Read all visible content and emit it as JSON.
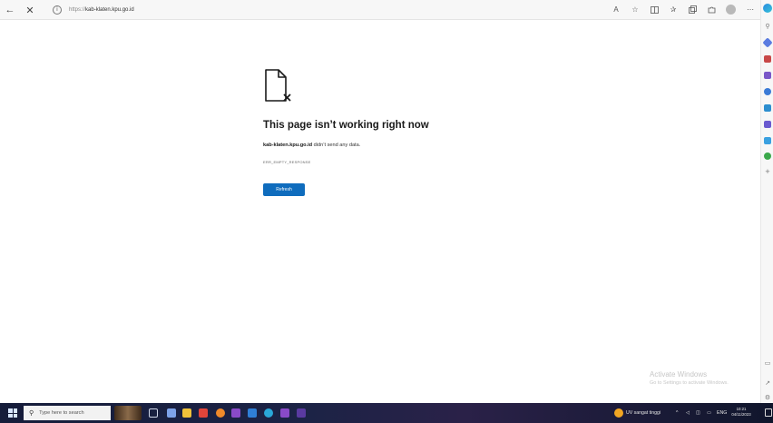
{
  "browser": {
    "url_protocol": "https://",
    "url_host": "kab-klaten.kpu.go.id",
    "back_glyph": "←",
    "close_glyph": "✕"
  },
  "error_page": {
    "title": "This page isn’t working right now",
    "site": "kab-klaten.kpu.go.id",
    "message": " didn’t send any data.",
    "error_code": "ERR_EMPTY_RESPONSE",
    "refresh_label": "Refresh"
  },
  "watermark": {
    "line1": "Activate Windows",
    "line2": "Go to Settings to activate Windows."
  },
  "taskbar": {
    "search_placeholder": "Type here to search",
    "weather_text": "UV sangat tinggi",
    "language": "ENG",
    "time": "10:21",
    "date": "04/11/2023"
  },
  "colors": {
    "accent": "#0f6cbd",
    "taskbar": "#151c3a"
  },
  "icons": [
    "back-icon",
    "close-icon",
    "info-icon",
    "read-aloud-icon",
    "favorite-icon",
    "split-screen-icon",
    "favorites-icon",
    "collections-icon",
    "extensions-icon",
    "profile-icon",
    "more-icon",
    "copilot-icon",
    "sad-page-icon",
    "windows-start-icon",
    "search-icon"
  ]
}
